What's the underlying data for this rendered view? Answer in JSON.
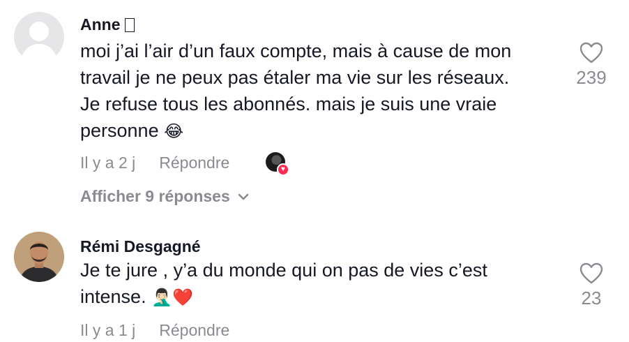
{
  "comments": [
    {
      "username": "Anne",
      "text_lines": [
        "moi j’ai l’air d’un faux compte, mais à cause de mon",
        "travail je ne peux pas étaler ma vie sur les réseaux.",
        "Je refuse tous les abonnés. mais je suis une vraie",
        "personne"
      ],
      "emoji": "😂",
      "time": "Il y a 2 j",
      "reply_label": "Répondre",
      "likes": "239",
      "view_replies": "Afficher 9 réponses"
    },
    {
      "username": "Rémi Desgagné",
      "text_lines": [
        "Je te jure , y’a du monde qui on pas de vies c’est",
        "intense."
      ],
      "emoji": "🤦🏻‍♂️❤️",
      "time": "Il y a 1 j",
      "reply_label": "Répondre",
      "likes": "23"
    }
  ],
  "colors": {
    "primary_text": "#161823",
    "secondary_text": "#8a8b91",
    "like_badge": "#fe2c55"
  },
  "icons": {
    "like": "heart-outline-icon",
    "expand": "chevron-down-icon",
    "creator_liked": "heart-badge-icon"
  }
}
